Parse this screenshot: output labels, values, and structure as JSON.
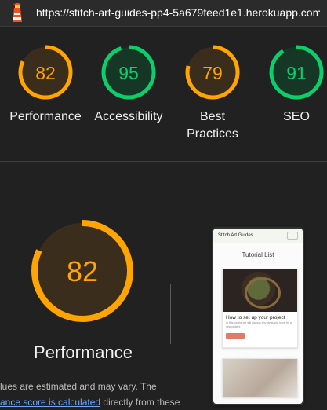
{
  "header": {
    "url": "https://stitch-art-guides-pp4-5a679feed1e1.herokuapp.com...",
    "logo_icon": "lighthouse-icon"
  },
  "scores": [
    {
      "label": "Performance",
      "value": 82,
      "fraction": 0.82,
      "color": "#ffa400"
    },
    {
      "label": "Accessibility",
      "value": 95,
      "fraction": 0.95,
      "color": "#0cce6b"
    },
    {
      "label": "Best Practices",
      "value": 79,
      "fraction": 0.79,
      "color": "#ffa400"
    },
    {
      "label": "SEO",
      "value": 91,
      "fraction": 0.91,
      "color": "#0cce6b"
    }
  ],
  "performance": {
    "title": "Performance",
    "score": 82,
    "fraction": 0.82,
    "description_pre": "lues are estimated and may vary. The",
    "description_link": "ance score is calculated",
    "description_post": "directly from these"
  },
  "screenshot": {
    "site_title": "Stitch Art Guides",
    "heading": "Tutorial List",
    "card_title": "How to set up your project",
    "card_text": "In this tutorial we will discuss any ideas you have for a new project."
  },
  "colors": {
    "background": "#212121",
    "average": "#ffa400",
    "pass": "#0cce6b",
    "link": "#6aa9ff"
  }
}
